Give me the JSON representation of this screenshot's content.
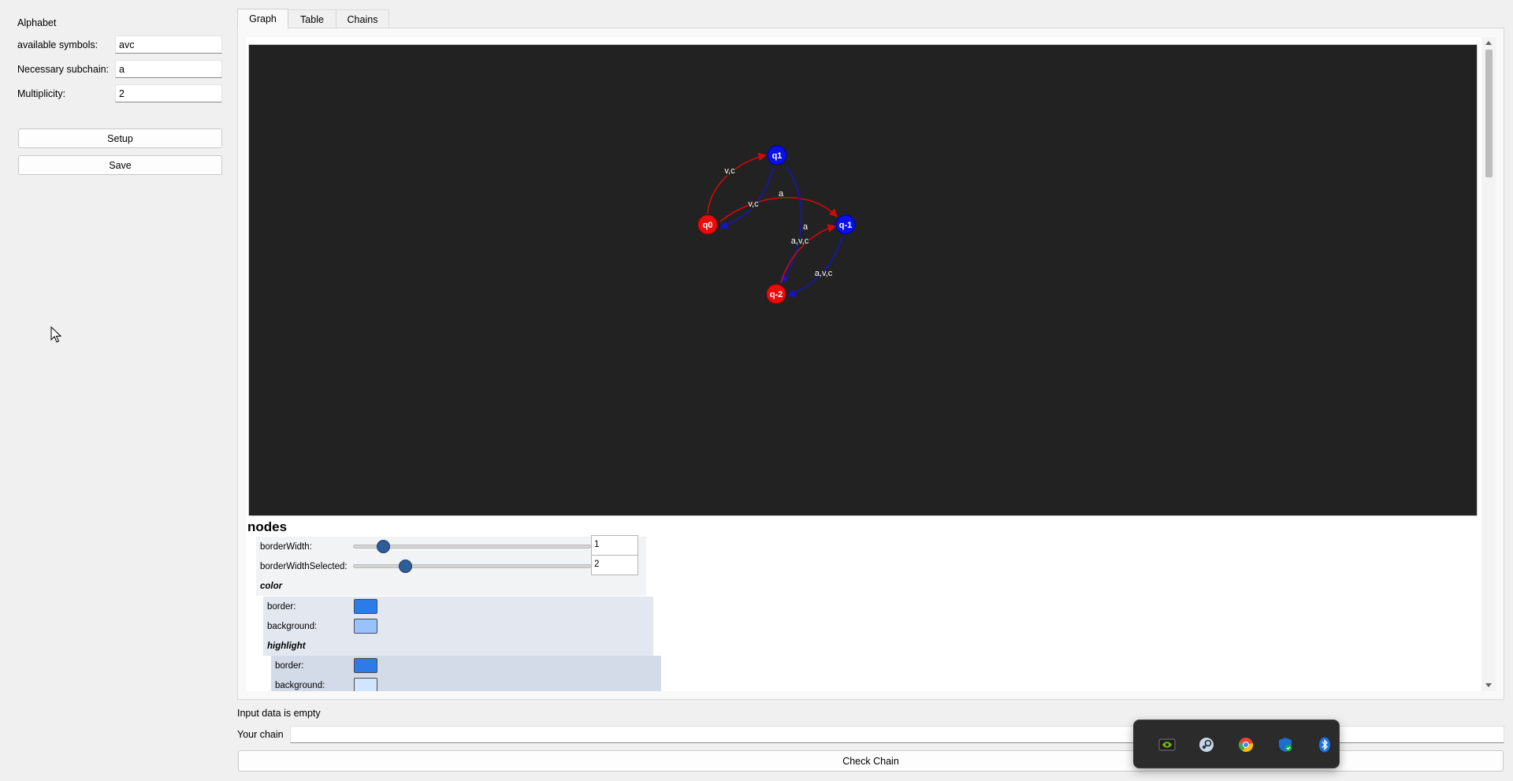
{
  "left_panel": {
    "section_title": "Alphabet",
    "available_symbols": {
      "label": "available symbols:",
      "value": "avc"
    },
    "necessary_subchain": {
      "label": "Necessary subchain:",
      "value": "a"
    },
    "multiplicity": {
      "label": "Multiplicity:",
      "value": "2"
    },
    "setup_label": "Setup",
    "save_label": "Save"
  },
  "tabs": [
    {
      "label": "Graph",
      "active": true
    },
    {
      "label": "Table",
      "active": false
    },
    {
      "label": "Chains",
      "active": false
    }
  ],
  "graph": {
    "nodes": [
      {
        "id": "q1",
        "label": "q1",
        "color": "#0a10e8"
      },
      {
        "id": "q0",
        "label": "q0",
        "color": "#ee0a0a"
      },
      {
        "id": "q-1",
        "label": "q-1",
        "color": "#0a10e8"
      },
      {
        "id": "q-2",
        "label": "q-2",
        "color": "#ee0a0a"
      }
    ],
    "edges": [
      {
        "from": "q0",
        "to": "q1",
        "label": "v,c",
        "color": "#d40a0a"
      },
      {
        "from": "q1",
        "to": "q0",
        "label": "v,c",
        "color": "#1414c8"
      },
      {
        "from": "q0",
        "to": "q-1",
        "label": "a",
        "color": "#d40a0a"
      },
      {
        "from": "q1",
        "to": "q-2",
        "label": "a",
        "color": "#1414c8"
      },
      {
        "from": "q-2",
        "to": "q-1",
        "label": "a,v,c",
        "color": "#d40a0a"
      },
      {
        "from": "q-1",
        "to": "q-2",
        "label": "a,v,c",
        "color": "#1414c8"
      }
    ]
  },
  "config": {
    "title": "nodes",
    "border_width": {
      "label": "borderWidth:",
      "value": "1",
      "fraction": 0.125
    },
    "border_width_selected": {
      "label": "borderWidthSelected:",
      "value": "2",
      "fraction": 0.22
    },
    "color_group": "color",
    "color_border": {
      "label": "border:",
      "color": "#2b7ce9"
    },
    "color_background": {
      "label": "background:",
      "color": "#97c2fc"
    },
    "highlight_group": "highlight",
    "highlight_border": {
      "label": "border:",
      "color": "#2b7ce9"
    },
    "highlight_background": {
      "label": "background:",
      "color": "#d2e5ff"
    }
  },
  "bottom": {
    "status": "Input data is empty",
    "chain_label": "Your chain",
    "chain_value": "",
    "check_label": "Check Chain"
  },
  "tray": {
    "icons": [
      "nvidia-icon",
      "steam-icon",
      "chrome-icon",
      "defender-icon",
      "bluetooth-icon"
    ]
  }
}
